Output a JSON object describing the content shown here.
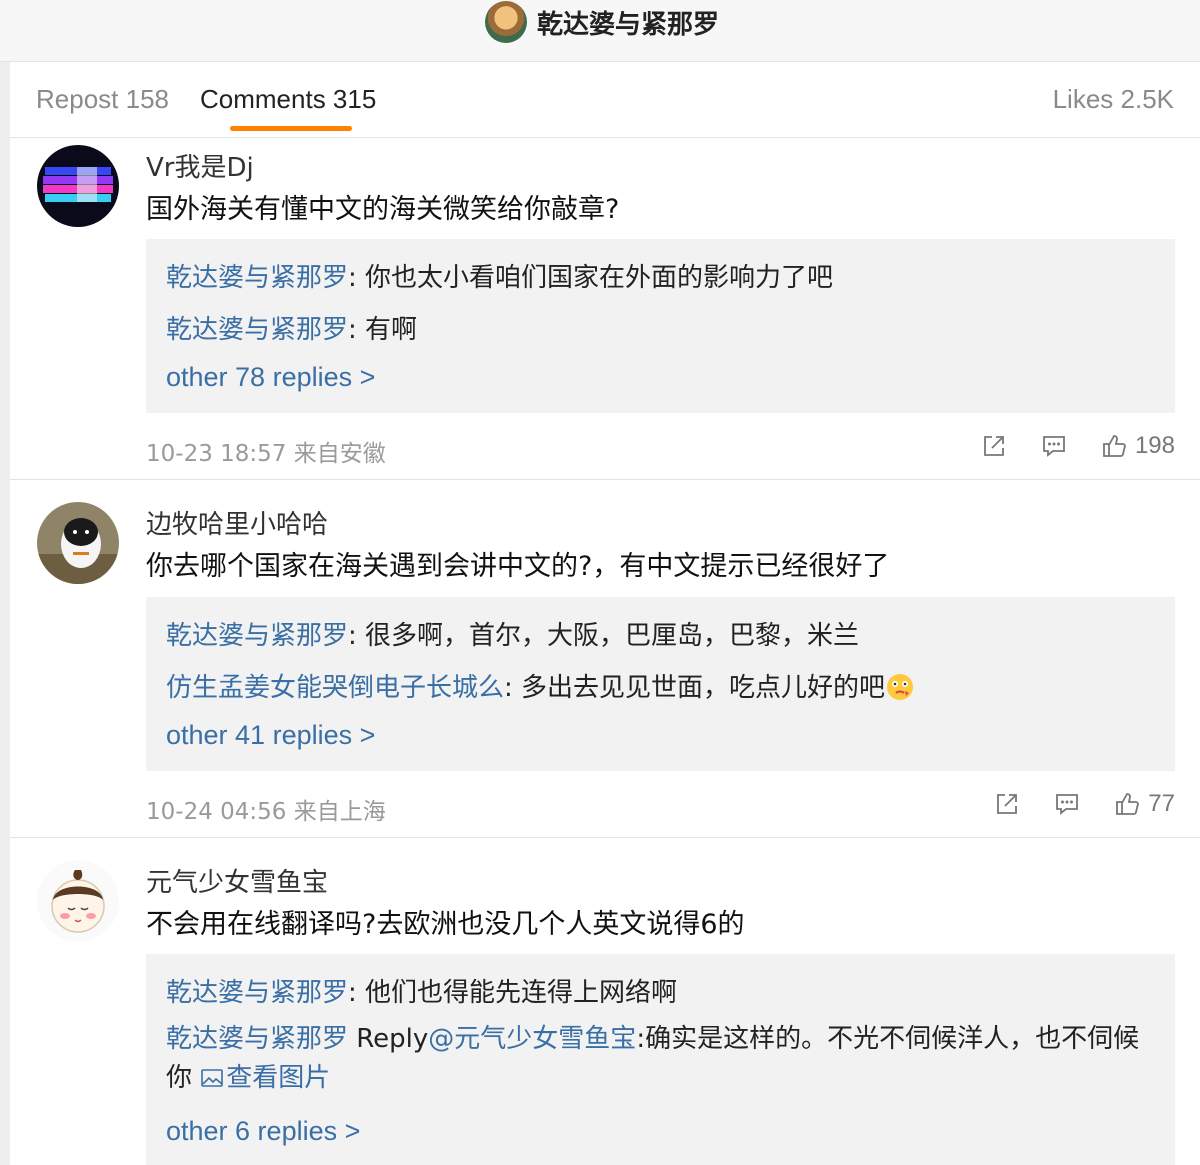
{
  "header": {
    "title": "乾达婆与紧那罗"
  },
  "tabs": [
    {
      "label": "Repost 158"
    },
    {
      "label": "Comments 315"
    },
    {
      "label": "Likes 2.5K"
    }
  ],
  "comments": [
    {
      "username": "Vr我是Dj",
      "content": "国外海关有懂中文的海关微笑给你敲章?",
      "replies": [
        {
          "user": "乾达婆与紧那罗",
          "sep": ": ",
          "text": "你也太小看咱们国家在外面的影响力了吧"
        },
        {
          "user": "乾达婆与紧那罗",
          "sep": ": ",
          "text": "有啊"
        }
      ],
      "more": "other 78 replies >",
      "meta": "10-23 18:57 来自安徽",
      "likes": "198"
    },
    {
      "username": "边牧哈里小哈哈",
      "content": "你去哪个国家在海关遇到会讲中文的?，有中文提示已经很好了",
      "replies": [
        {
          "user": "乾达婆与紧那罗",
          "sep": ": ",
          "text": "很多啊，首尔，大阪，巴厘岛，巴黎，米兰"
        },
        {
          "user": "仿生孟姜女能哭倒电子长城么",
          "sep": ": ",
          "text": "多出去见见世面，吃点儿好的吧"
        }
      ],
      "more": "other 41 replies >",
      "meta": "10-24 04:56 来自上海",
      "likes": "77"
    },
    {
      "username": "元气少女雪鱼宝",
      "content": "不会用在线翻译吗?去欧洲也没几个人英文说得6的",
      "replies": [
        {
          "user": "乾达婆与紧那罗",
          "sep": ": ",
          "text": "他们也得能先连得上网络啊"
        },
        {
          "user": "乾达婆与紧那罗",
          "reply_prefix": "Reply",
          "mention": "@元气少女雪鱼宝",
          "sep": ":",
          "text": "确实是这样的。不光不伺候洋人，也不伺候你",
          "link": "查看图片"
        }
      ],
      "more": "other 6 replies >"
    }
  ],
  "icons": [
    "share-icon",
    "comment-icon",
    "like-icon",
    "image-icon",
    "emoji-icon"
  ],
  "colors": {
    "accent": "#ff8200",
    "link": "#3a6fa5",
    "reply_bg": "#f2f2f2"
  }
}
